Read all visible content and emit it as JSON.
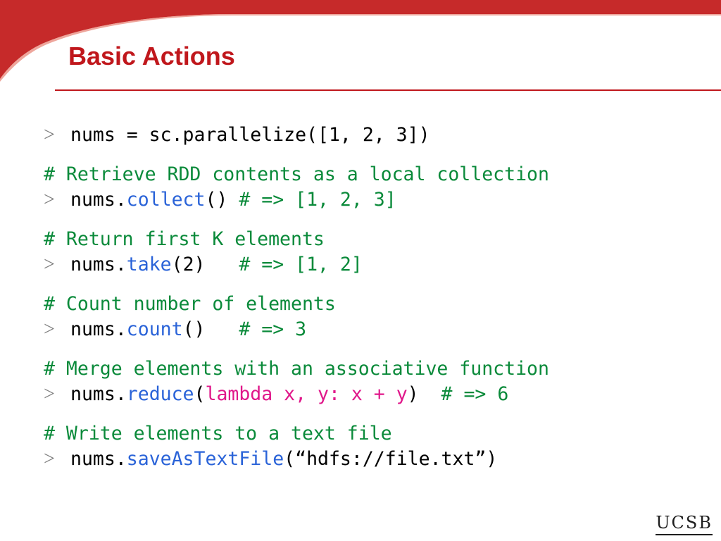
{
  "title": "Basic Actions",
  "prompt_symbol": ">",
  "blocks": [
    {
      "comment": "",
      "code": [
        {
          "text": "nums = sc.parallelize([1, 2, 3])",
          "type": "plain"
        }
      ]
    },
    {
      "comment": "# Retrieve RDD contents as a local collection",
      "code": [
        {
          "text": "nums.",
          "type": "plain"
        },
        {
          "text": "collect",
          "type": "method"
        },
        {
          "text": "() # => [1, 2, 3]",
          "type": "plain-comment-tail"
        }
      ]
    },
    {
      "comment": "# Return first K elements",
      "code": [
        {
          "text": "nums.",
          "type": "plain"
        },
        {
          "text": "take",
          "type": "method"
        },
        {
          "text": "(2)",
          "type": "plain"
        },
        {
          "text": "   # => [1, 2]",
          "type": "comment"
        }
      ]
    },
    {
      "comment": "# Count number of elements",
      "code": [
        {
          "text": "nums.",
          "type": "plain"
        },
        {
          "text": "count",
          "type": "method"
        },
        {
          "text": "()",
          "type": "plain"
        },
        {
          "text": "   # => 3",
          "type": "comment"
        }
      ]
    },
    {
      "comment": "# Merge elements with an associative function",
      "code": [
        {
          "text": "nums.",
          "type": "plain"
        },
        {
          "text": "reduce",
          "type": "method"
        },
        {
          "text": "(",
          "type": "plain"
        },
        {
          "text": "lambda x, y: x + y",
          "type": "lambda"
        },
        {
          "text": ")",
          "type": "plain"
        },
        {
          "text": "  # => 6",
          "type": "comment"
        }
      ]
    },
    {
      "comment": "# Write elements to a text file",
      "code": [
        {
          "text": "nums.",
          "type": "plain"
        },
        {
          "text": "saveAsTextFile",
          "type": "method"
        },
        {
          "text": "(“hdfs://file.txt”)",
          "type": "plain"
        }
      ]
    }
  ],
  "logo": {
    "text": "UCSB",
    "icon": "ucsb-logo-icon"
  },
  "colors": {
    "title": "#c0171c",
    "comment": "#0a8a3a",
    "method": "#2a63d8",
    "lambda": "#e0178a",
    "prompt": "#7f7f7f",
    "header_band": "#c62a2a"
  }
}
